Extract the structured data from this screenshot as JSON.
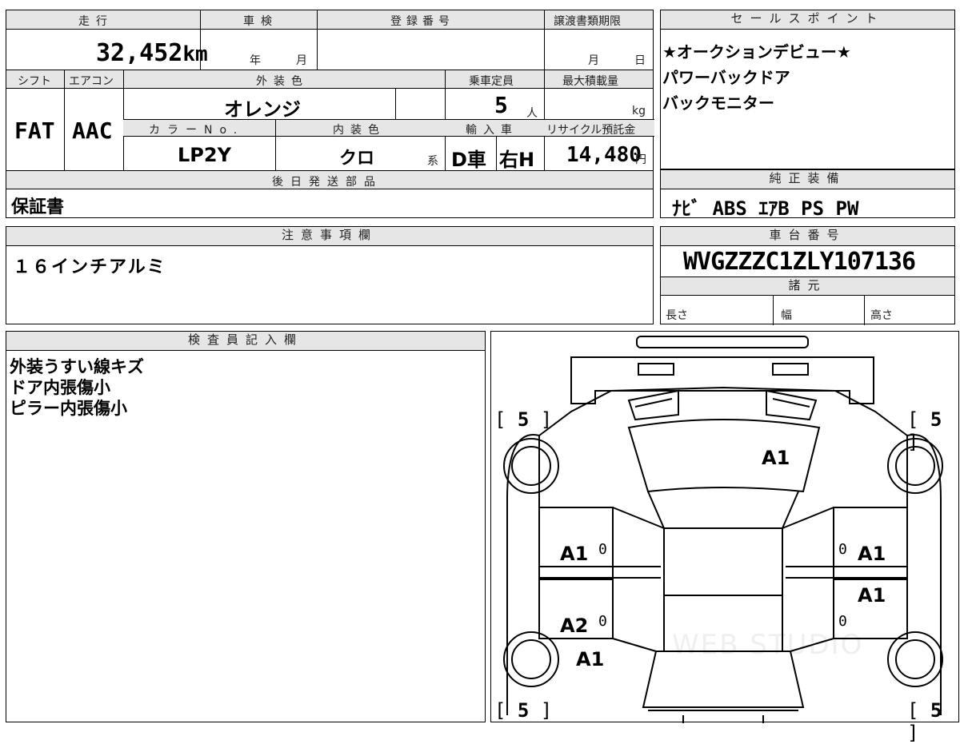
{
  "top_form": {
    "headers": {
      "mileage": "走行",
      "inspection": "車検",
      "registration": "登録番号",
      "transfer_deadline": "譲渡書類期限",
      "shift": "シフト",
      "aircon": "エアコン",
      "exterior_color": "外装色",
      "capacity": "乗車定員",
      "max_load": "最大積載量",
      "color_no": "カラーNo.",
      "interior_color": "内装色",
      "import": "輸入車",
      "recycle": "リサイクル預託金",
      "later_parts": "後日発送部品"
    },
    "mileage_value": "32,452",
    "mileage_unit": "km",
    "inspection_year": "年",
    "inspection_month": "月",
    "deadline_month": "月",
    "deadline_day": "日",
    "shift_value": "FAT",
    "aircon_value": "AAC",
    "exterior_value": "オレンジ",
    "capacity_value": "5",
    "capacity_unit": "人",
    "load_unit": "kg",
    "color_no_value": "LP2Y",
    "interior_value": "クロ",
    "interior_suffix": "系",
    "import_value": "D車",
    "handle_value": "右H",
    "recycle_value": "14,480",
    "recycle_unit": "円",
    "later_parts_value": "保証書"
  },
  "sales_points": {
    "header": "セールスポイント",
    "lines": [
      "★オークションデビュー★",
      "パワーバックドア",
      "バックモニター"
    ]
  },
  "equipment": {
    "header": "純正装備",
    "value": "ﾅﾋﾞ ABS ｴｱB PS PW"
  },
  "notes": {
    "header": "注意事項欄",
    "value": "１６インチアルミ"
  },
  "chassis": {
    "header": "車台番号",
    "value": "WVGZZZC1ZLY107136",
    "spec_header": "諸元",
    "length": "長さ",
    "width": "幅",
    "height": "高さ"
  },
  "inspector": {
    "header": "検査員記入欄",
    "lines": [
      "外装うすい線キズ",
      "ドア内張傷小",
      "ピラー内張傷小"
    ]
  },
  "diagram": {
    "tires": [
      "5",
      "5",
      "5",
      "5"
    ],
    "marks": {
      "hood": "A1",
      "left_front_door": "A1",
      "right_front_door": "A1",
      "right_rear_door": "A1",
      "left_rear_door": "A2",
      "left_rear_fender": "A1"
    },
    "zeros": [
      "0",
      "0",
      "0",
      "0"
    ],
    "watermark": "WEB STUDIO"
  }
}
